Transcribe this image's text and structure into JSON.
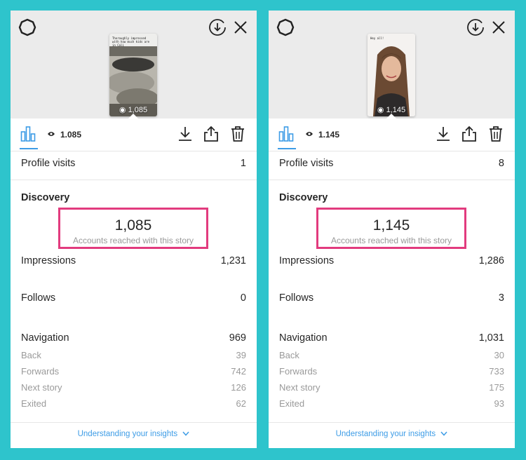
{
  "colors": {
    "background": "#2ec4cc",
    "accent_blue": "#3d9ce6",
    "highlight_pink": "#e23b7e",
    "header_gray": "#ebebeb"
  },
  "panels": [
    {
      "story_view_overlay": "1,085",
      "story_caption": "Thoroughly impressed with how much kids are in Cali",
      "views": "1.085",
      "profile_visits_label": "Profile visits",
      "profile_visits": "1",
      "discovery_label": "Discovery",
      "accounts_reached": "1,085",
      "accounts_reached_label": "Accounts reached with this story",
      "impressions_label": "Impressions",
      "impressions": "1,231",
      "follows_label": "Follows",
      "follows": "0",
      "navigation_label": "Navigation",
      "navigation": "969",
      "back_label": "Back",
      "back": "39",
      "forwards_label": "Forwards",
      "forwards": "742",
      "next_story_label": "Next story",
      "next_story": "126",
      "exited_label": "Exited",
      "exited": "62",
      "footer_link": "Understanding your insights"
    },
    {
      "story_view_overlay": "1,145",
      "story_caption": "Hey all!",
      "views": "1.145",
      "profile_visits_label": "Profile visits",
      "profile_visits": "8",
      "discovery_label": "Discovery",
      "accounts_reached": "1,145",
      "accounts_reached_label": "Accounts reached with this story",
      "impressions_label": "Impressions",
      "impressions": "1,286",
      "follows_label": "Follows",
      "follows": "3",
      "navigation_label": "Navigation",
      "navigation": "1,031",
      "back_label": "Back",
      "back": "30",
      "forwards_label": "Forwards",
      "forwards": "733",
      "next_story_label": "Next story",
      "next_story": "175",
      "exited_label": "Exited",
      "exited": "93",
      "footer_link": "Understanding your insights"
    }
  ]
}
